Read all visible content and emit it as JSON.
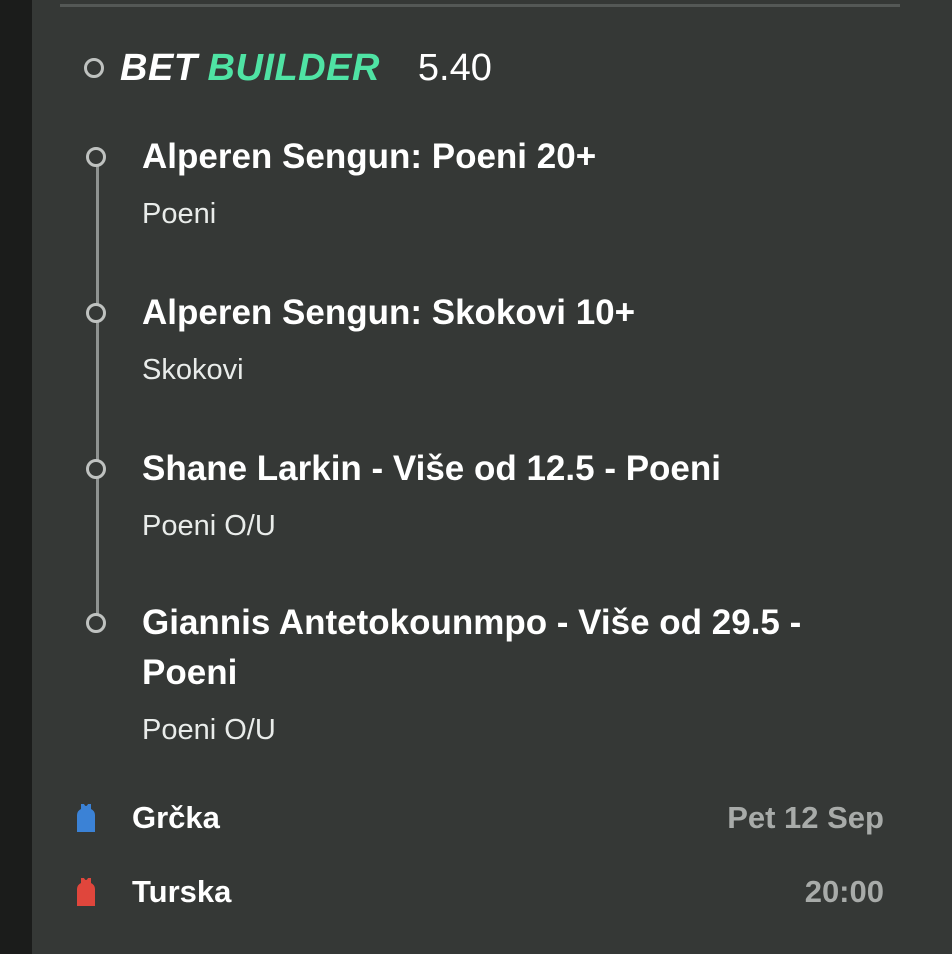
{
  "header": {
    "brand_bet": "BET",
    "brand_builder": "BUILDER",
    "odds": "5.40"
  },
  "selections": [
    {
      "title": "Alperen Sengun: Poeni 20+",
      "market": "Poeni"
    },
    {
      "title": "Alperen Sengun: Skokovi 10+",
      "market": "Skokovi"
    },
    {
      "title": "Shane Larkin - Više od 12.5 - Poeni",
      "market": "Poeni O/U"
    },
    {
      "title": "Giannis Antetokounmpo - Više od 29.5 - Poeni",
      "market": "Poeni O/U"
    }
  ],
  "match": {
    "home": {
      "name": "Grčka",
      "meta": "Pet 12 Sep",
      "icon": "blue-jersey-icon",
      "color": "#3b82d6"
    },
    "away": {
      "name": "Turska",
      "meta": "20:00",
      "icon": "red-jersey-icon",
      "color": "#e0463c"
    }
  },
  "colors": {
    "background": "#353836",
    "accent": "#4fe3a4",
    "text": "#ffffff",
    "muted": "#a8aba9"
  }
}
